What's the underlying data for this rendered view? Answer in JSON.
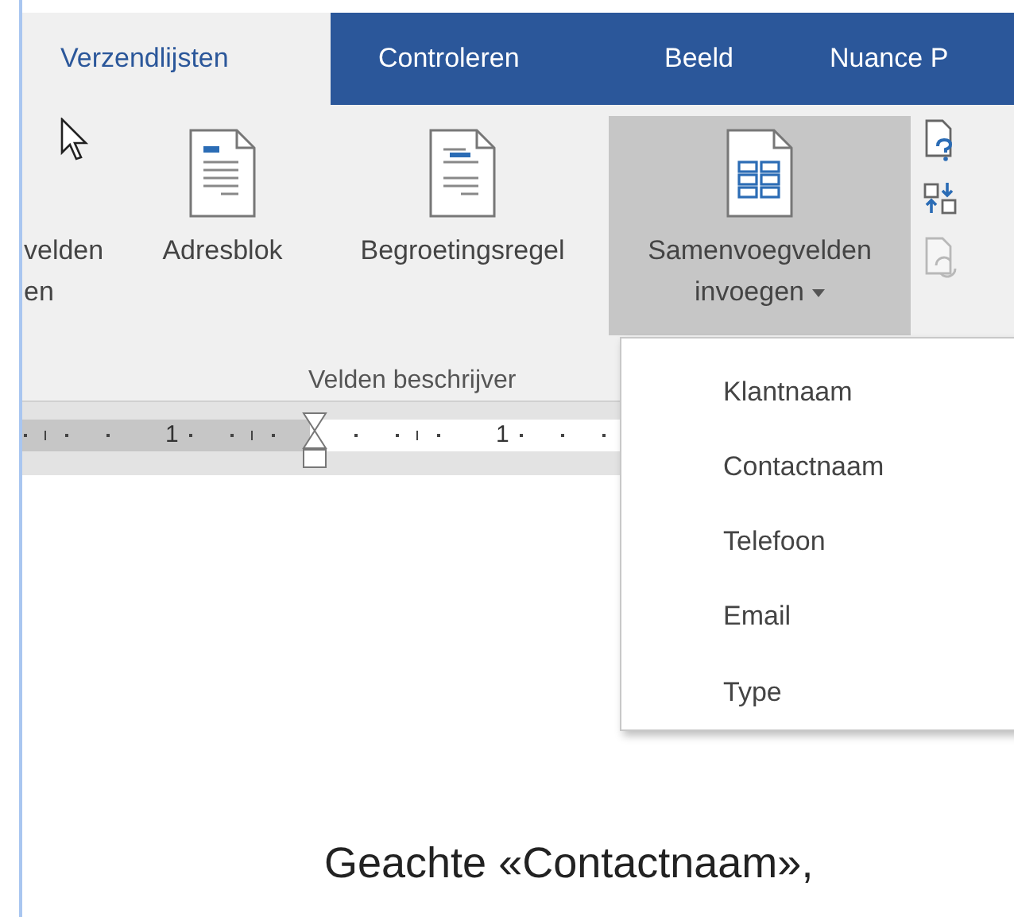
{
  "tabs": [
    {
      "label": "Verzendlijsten",
      "selected": true
    },
    {
      "label": "Controleren",
      "selected": false
    },
    {
      "label": "Beeld",
      "selected": false
    },
    {
      "label": "Nuance P",
      "selected": false
    }
  ],
  "ribbon": {
    "buttons": [
      {
        "kind": "partial",
        "label": "velden",
        "label_2": "en",
        "selected": false
      },
      {
        "kind": "address",
        "label": "Adresblok",
        "selected": false
      },
      {
        "kind": "greeting",
        "label": "Begroetingsregel",
        "selected": false
      },
      {
        "kind": "merge",
        "label": "Samenvoegvelden",
        "label_2": "invoegen",
        "dropdown": true,
        "selected": true
      }
    ],
    "small_buttons": [
      {
        "kind": "help",
        "disabled": false
      },
      {
        "kind": "match",
        "disabled": false
      },
      {
        "kind": "update",
        "disabled": true
      }
    ],
    "group_label": "Velden beschrijver"
  },
  "ruler": {
    "labels": [
      "1",
      "1"
    ]
  },
  "menu": {
    "items": [
      "Klantnaam",
      "Contactnaam",
      "Telefoon",
      "Email",
      "Type"
    ]
  },
  "document": {
    "text": "Geachte «Contactnaam»,"
  }
}
